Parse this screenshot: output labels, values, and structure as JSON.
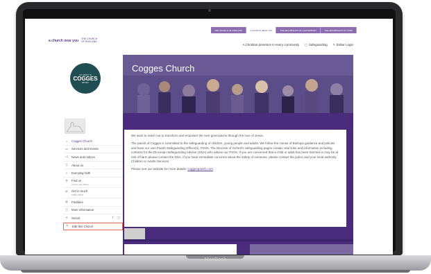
{
  "device": {
    "label": "MacBook"
  },
  "topbar": {
    "tabs": [
      {
        "label": "THE CHURCH OF ENGLAND",
        "active": false
      },
      {
        "label": "A CHURCH NEAR YOU",
        "active": true
      },
      {
        "label": "THE ARCHBISHOP OF CANTERBURY",
        "active": false
      },
      {
        "label": "THE ARCHBISHOP OF YORK",
        "active": false
      }
    ]
  },
  "header": {
    "logo_mark": "a church near you",
    "logo_coe": "THE CHURCH OF ENGLAND",
    "tagline": "A Christian presence in every community",
    "safeguarding": "Safeguarding",
    "editor_login": "Editor Login"
  },
  "badge": {
    "top": "ST MARY'S",
    "name": "COGGES",
    "bottom": "WITNEY"
  },
  "nav": {
    "items": [
      {
        "label": "Cogges Church",
        "icon": "home-icon",
        "active": true
      },
      {
        "label": "Services and events",
        "icon": "calendar-icon"
      },
      {
        "label": "News and notices",
        "icon": "megaphone-icon"
      },
      {
        "label": "About us",
        "icon": "info-icon"
      },
      {
        "label": "Everyday faith",
        "icon": "circle-icon"
      }
    ],
    "find_us": {
      "label": "Find us",
      "sub": "Church Lane Witney"
    },
    "get_in_touch": {
      "label": "Get in touch",
      "sub": "01993 778111"
    },
    "facilities": {
      "label": "Facilities"
    },
    "more_info": {
      "label": "More information"
    },
    "social": {
      "label": "Social"
    },
    "edit": {
      "label": "Edit this Church"
    }
  },
  "hero": {
    "title": "Cogges Church"
  },
  "content": {
    "p1": "We want to reach out to transform and empower the next generations through the love of Jesus.",
    "p2": "The parish of Cogges is committed to the safeguarding of children, young people and adults. We follow the House of Bishops guidance and policies and have our own Parish Safeguarding Officer(s), PSOs. The Diocese of Oxford's safeguarding pages contain vital links and information including contacts for the Diocesan Safeguarding Advisor (DSA) who advise our PSOs. If you are concerned that a child or adult has been harmed or may be at risk of harm please contact the DSA. If you have immediate concerns about the safety of someone, please contact the police and your local authority Children or Adults Services.",
    "p3_prefix": "Please see our website for more details: ",
    "p3_link": "coggesparish.com"
  }
}
